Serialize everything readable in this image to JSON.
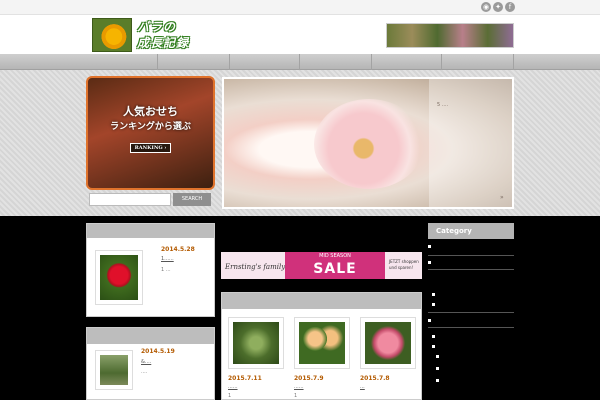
{
  "header": {
    "logo_line1": "バラの",
    "logo_line2": "成長記録"
  },
  "social": {
    "icons": [
      "rss-icon",
      "twitter-icon",
      "facebook-icon"
    ],
    "icon_glyphs": [
      "◉",
      "✦",
      "f"
    ]
  },
  "promo": {
    "line1": "人気おせち",
    "line2": "ランキングから選ぶ",
    "button": "RANKING ›"
  },
  "search": {
    "placeholder": "",
    "button": "SEARCH"
  },
  "slider": {
    "caption": "5 ....",
    "arrow": "»"
  },
  "left_posts": [
    {
      "date": "2014.5.28",
      "title": "1......",
      "excerpt": "1 ..."
    },
    {
      "date": "2014.5.19",
      "title": "&....",
      "excerpt": "...."
    }
  ],
  "ad": {
    "brand": "Ernsting's family",
    "mid": "MID SEASON",
    "sale": "SALE",
    "small_line1": "JETZT shoppen",
    "small_line2": "und sparen!"
  },
  "grid_posts": [
    {
      "date": "2015.7.11",
      "title": "......",
      "excerpt": "1"
    },
    {
      "date": "2015.7.9",
      "title": "......",
      "excerpt": "1"
    },
    {
      "date": "2015.7.8",
      "title": "...",
      "excerpt": ""
    }
  ],
  "sidebar": {
    "category_title": "Category"
  },
  "colors": {
    "accent_orange": "#e0732c",
    "date_color": "#b35a00",
    "ad_pink": "#d0317b",
    "logo_green": "#2f7d1c"
  }
}
